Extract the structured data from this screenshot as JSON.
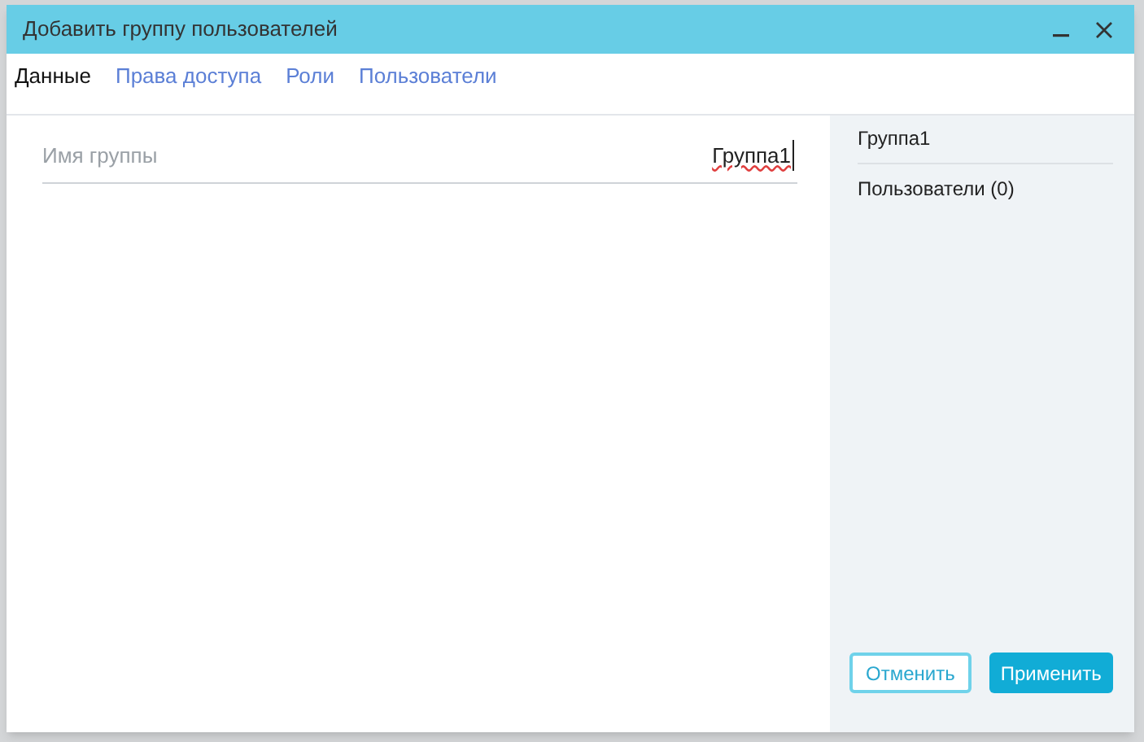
{
  "window": {
    "title": "Добавить группу пользователей"
  },
  "tabs": [
    {
      "label": "Данные",
      "selected": true
    },
    {
      "label": "Права доступа",
      "selected": false
    },
    {
      "label": "Роли",
      "selected": false
    },
    {
      "label": "Пользователи",
      "selected": false
    }
  ],
  "form": {
    "field_label": "Имя группы",
    "value": "Группа1"
  },
  "summary": {
    "title": "Группа1",
    "users": "Пользователи (0)"
  },
  "buttons": {
    "cancel": "Отменить",
    "apply": "Применить"
  }
}
